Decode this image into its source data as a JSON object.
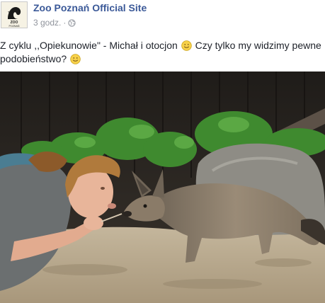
{
  "post": {
    "author": "Zoo Poznań Official Site",
    "timestamp": "3 godz.",
    "separator": "·",
    "audience_icon": "globe-icon",
    "avatar": {
      "logo_word": "ZOO",
      "logo_caption": "POZNAŃ"
    },
    "text_line_1": "Z cyklu ,,Opiekunowie\" - Michał i otocjon",
    "text_line_1_after": "Czy tylko my widzimy pewne",
    "text_line_2": "podobieństwo?",
    "emoji": "smile-emoji",
    "photo": {
      "description_icon": "photo",
      "colors": {
        "wall": "#2a2622",
        "foliage": "#3f8a2f",
        "rock": "#8e8c85",
        "sand": "#b7a88f",
        "fox_fur": "#8a7b68",
        "shirt": "#6b6f70",
        "hair": "#b07a3c"
      }
    }
  },
  "colors": {
    "link": "#3b5998",
    "meta": "#90949c",
    "text": "#1d2129"
  }
}
